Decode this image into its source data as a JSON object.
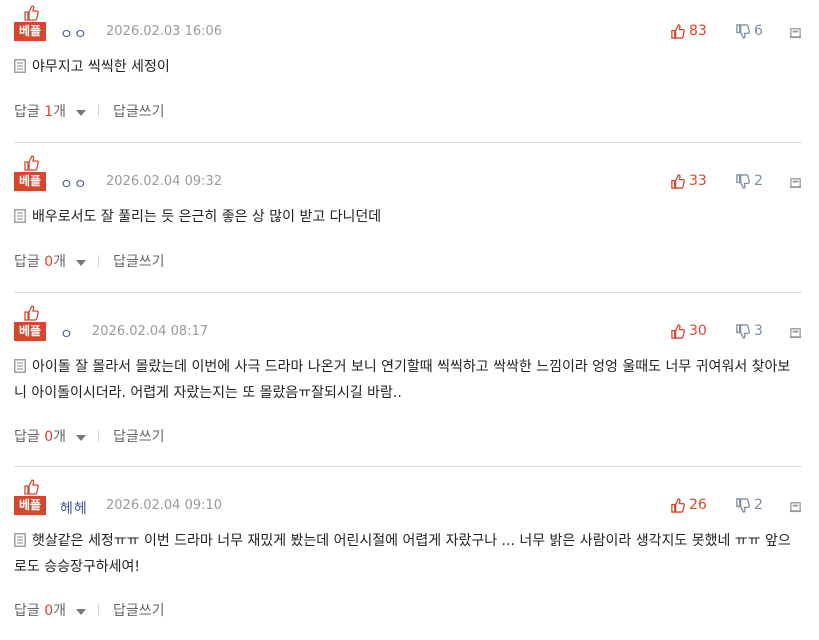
{
  "best_label": "베플",
  "reply_label": "답글",
  "reply_unit": "개",
  "write_reply_label": "답글쓰기",
  "colors": {
    "accent": "#d6462c",
    "nick": "#3a5a9a",
    "downvote": "#7a8ea8",
    "date": "#9a9a9a"
  },
  "comments": [
    {
      "nick": "ㅇㅇ",
      "date": "2026.02.03 16:06",
      "up": "83",
      "down": "6",
      "body": "야무지고 씩씩한 세정이",
      "reply_count": "1"
    },
    {
      "nick": "ㅇㅇ",
      "date": "2026.02.04 09:32",
      "up": "33",
      "down": "2",
      "body": "배우로서도 잘 풀리는 듯 은근히 좋은 상 많이 받고 다니던데",
      "reply_count": "0"
    },
    {
      "nick": "ㅇ",
      "date": "2026.02.04 08:17",
      "up": "30",
      "down": "3",
      "body": "아이돌 잘 몰라서 몰랐는데 이번에 사극 드라마 나온거 보니 연기할때 씩씩하고 싹싹한 느낌이라 엉엉 울때도 너무 귀여워서 찾아보니 아이돌이시더라. 어렵게 자랐는지는 또 몰랐음ㅠ잘되시길 바람..",
      "reply_count": "0"
    },
    {
      "nick": "헤헤",
      "date": "2026.02.04 09:10",
      "up": "26",
      "down": "2",
      "body": "햇살같은 세정ㅠㅠ 이번 드라마 너무 재밌게 봤는데 어린시절에 어렵게 자랐구나 ... 너무 밝은 사람이라 생각지도 못했네 ㅠㅠ 앞으로도 승승장구하세여!",
      "reply_count": "0"
    }
  ]
}
